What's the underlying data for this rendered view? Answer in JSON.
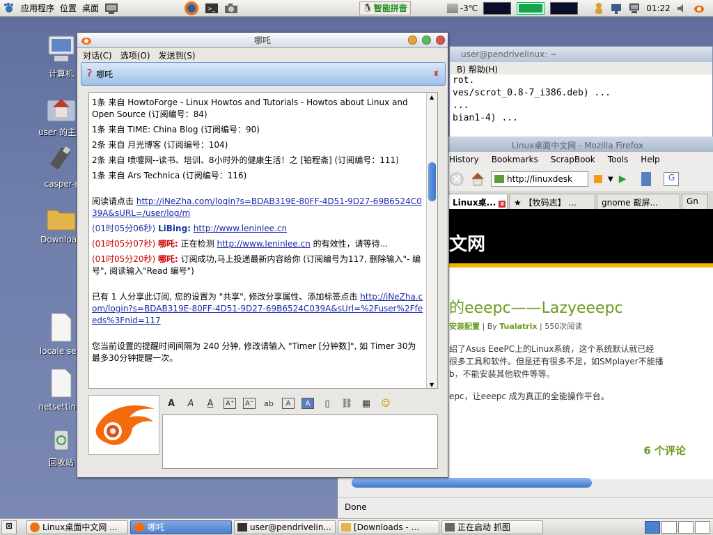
{
  "top_panel": {
    "menus": [
      "应用程序",
      "位置",
      "桌面"
    ],
    "ime_label": "智能拼音",
    "temperature": "-3℃",
    "clock": "01:22"
  },
  "desktop_icons": [
    "计算机",
    "user 的主文",
    "casper-r",
    "Download",
    "locale sett",
    "netsetting.",
    "回收站"
  ],
  "terminal": {
    "title": "user@pendrivelinux: ~",
    "menu_partial": "B) 帮助(H)",
    "lines": [
      "rot.",
      "ves/scrot_0.8-7_i386.deb) ...",
      "...",
      "",
      "bian1-4) ..."
    ]
  },
  "firefox": {
    "title": "Linux桌面中文网 - Mozilla Firefox",
    "menu": [
      "History",
      "Bookmarks",
      "ScrapBook",
      "Tools",
      "Help"
    ],
    "url": "http://linuxdesk",
    "tabs": [
      "Linux桌...",
      "【牧码志】 ...",
      "gnome 截屏...",
      "Gn"
    ],
    "site_banner": "文网",
    "post_title": "的eeepc——Lazyeeepc",
    "post_meta_category": "安装配置",
    "post_meta_author": "Tualatrix",
    "post_meta_reads": "550次阅读",
    "body_lines": [
      "绍了Asus EeePC上的Linux系统，这个系统默认就已经",
      "很多工具和软件。但是还有很多不足，如SMplayer不能播",
      "b，不能安装其他软件等等。",
      "epc，让eeepc 成为真正的全能操作平台。"
    ],
    "comments": "6 个评论",
    "status": "Done"
  },
  "chat": {
    "title": "哪吒",
    "menu": [
      "对话(C)",
      "选项(O)",
      "发送到(S)"
    ],
    "contact": "哪吒",
    "messages": {
      "sub1": "1条 来自 HowtoForge - Linux Howtos and Tutorials - Howtos about Linux and Open Source (订阅编号：84)",
      "sub2": "1条 来自 TIME: China Blog (订阅编号：90)",
      "sub3": "2条 来自 月光博客 (订阅编号：104)",
      "sub4": "2条 来自 喷嚏网--读书、培训、8小时外的健康生活！之 [铂程斋] (订阅编号：111)",
      "sub5": "1条 来自 Ars Technica (订阅编号：116)",
      "read_prefix": "阅读请点击",
      "read_link": "http://iNeZha.com/login?s=BDAB319E-80FF-4D51-9D27-69B6524C039A&sURL=/user/log/m",
      "m1_time": "(01时05分06秒)",
      "m1_name": "LiBing:",
      "m1_link": "http://www.leninlee.cn",
      "m2_time": "(01时05分07秒)",
      "m2_name": "哪吒:",
      "m2_pre": "正在检测",
      "m2_link": "http://www.leninlee.cn",
      "m2_post": "的有效性，请等待...",
      "m3_time": "(01时05分20秒)",
      "m3_name": "哪吒:",
      "m3_text": "订阅成功,马上投递最新内容给你 (订阅编号为117, 删除输入\"- 编号\", 阅读输入\"Read 编号\")",
      "share_text": "已有 1 人分享此订阅, 您的设置为 \"共享\", 修改分享属性、添加标签点击",
      "share_link": "http://iNeZha.com/login?s=BDAB319E-80FF-4D51-9D27-69B6524C039A&sUrl=%2Fuser%2Ffeeds%3Fnid=117",
      "remind_text": "您当前设置的提醒时间间隔为 240 分钟, 修改请输入 \"Timer [分钟数]\", 如 Timer 30为最多30分钟提醒一次。"
    }
  },
  "taskbar": [
    "Linux桌面中文网 ...",
    "哪吒",
    "user@pendrivelin...",
    "[Downloads - ...",
    "正在启动 抓图"
  ]
}
